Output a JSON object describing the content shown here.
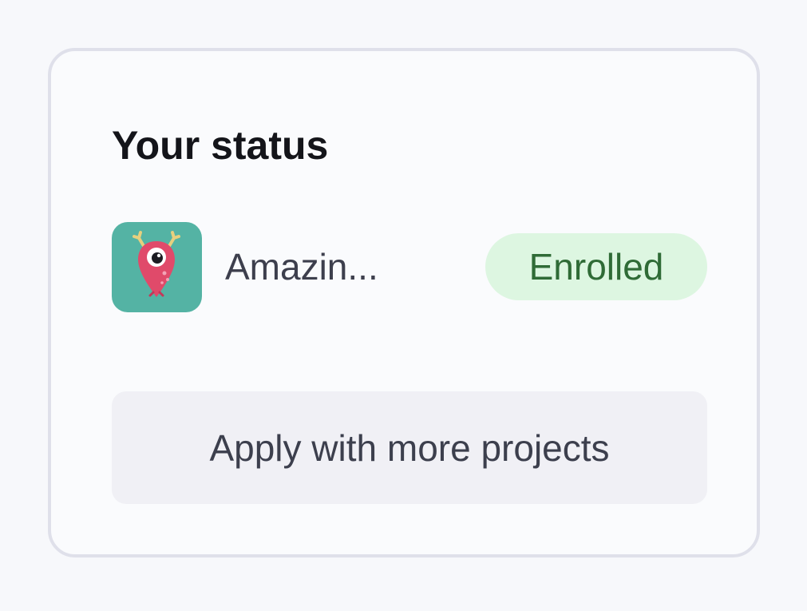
{
  "status_card": {
    "title": "Your status",
    "project": {
      "name": "Amazin...",
      "icon": "monster-pin-icon",
      "status": "Enrolled"
    },
    "apply_button_label": "Apply with more projects"
  },
  "colors": {
    "card_border": "#dfe0ea",
    "badge_background": "#ddf6e1",
    "badge_text": "#2f6b36",
    "icon_background": "#54b3a4",
    "button_background": "#f0f0f5"
  }
}
